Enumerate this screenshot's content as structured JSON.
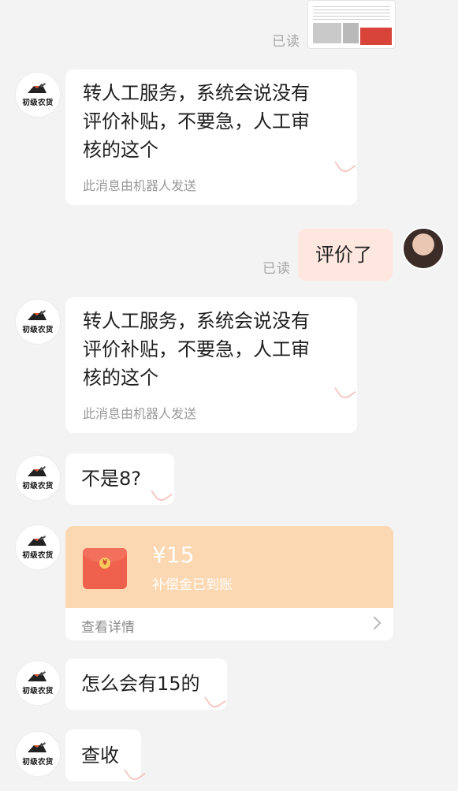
{
  "messages": {
    "read_status_1": "已读",
    "read_status_2": "已读",
    "bot_brand": "初级农货",
    "bot_msg_1": {
      "line1": "转人工服务，系统会说没有",
      "line2": "评价补贴，不要急，人工审",
      "line3": "核的这个",
      "note": "此消息由机器人发送"
    },
    "user_msg_1": "评价了",
    "bot_msg_2": {
      "line1": "转人工服务，系统会说没有",
      "line2": "评价补贴，不要急，人工审",
      "line3": "核的这个",
      "note": "此消息由机器人发送"
    },
    "bot_msg_3": "不是8?",
    "red_packet": {
      "amount": "¥15",
      "status": "补偿金已到账",
      "detail": "查看详情"
    },
    "bot_msg_4": "怎么会有15的",
    "bot_msg_5": "查收"
  },
  "colors": {
    "background": "#f3f3f3",
    "bubble": "#ffffff",
    "user_bubble": "#fde7df",
    "red_packet_top": "#fbd8b2",
    "envelope": "#f0614d"
  },
  "icons": [
    "bot-avatar-icon",
    "user-avatar-icon",
    "envelope-icon",
    "chevron-right-icon"
  ]
}
